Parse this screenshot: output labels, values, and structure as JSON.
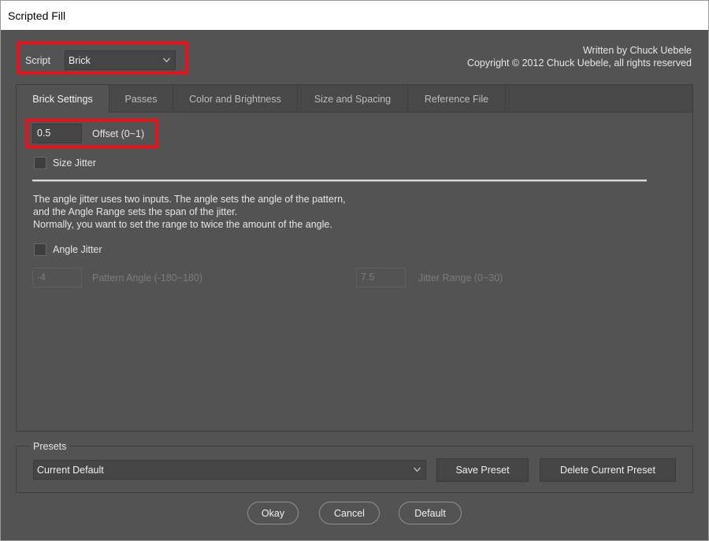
{
  "window": {
    "title": "Scripted Fill"
  },
  "script": {
    "label": "Script",
    "selected": "Brick"
  },
  "credits": {
    "author": "Written by Chuck Uebele",
    "copyright": "Copyright © 2012 Chuck Uebele, all rights reserved"
  },
  "tabs": [
    {
      "label": "Brick Settings",
      "active": true
    },
    {
      "label": "Passes"
    },
    {
      "label": "Color and Brightness"
    },
    {
      "label": "Size and Spacing"
    },
    {
      "label": "Reference File"
    }
  ],
  "brick": {
    "offset_value": "0.5",
    "offset_label": "Offset (0~1)",
    "size_jitter_label": "Size Jitter",
    "size_jitter_checked": false,
    "description": [
      "The angle jitter uses two inputs.  The angle sets the angle of the pattern,",
      "and the Angle Range sets the span of the jitter.",
      "Normally, you want to set the range to twice the amount of the angle."
    ],
    "angle_jitter_label": "Angle Jitter",
    "angle_jitter_checked": false,
    "pattern_angle_value": "-4",
    "pattern_angle_label": "Pattern Angle (-180~180)",
    "jitter_range_value": "7.5",
    "jitter_range_label": "Jitter Range (0~30)"
  },
  "presets": {
    "title": "Presets",
    "selected": "Current Default",
    "save_label": "Save Preset",
    "delete_label": "Delete Current Preset"
  },
  "footer": {
    "okay": "Okay",
    "cancel": "Cancel",
    "default": "Default"
  },
  "colors": {
    "highlight": "#e8101a",
    "background": "#535353"
  }
}
